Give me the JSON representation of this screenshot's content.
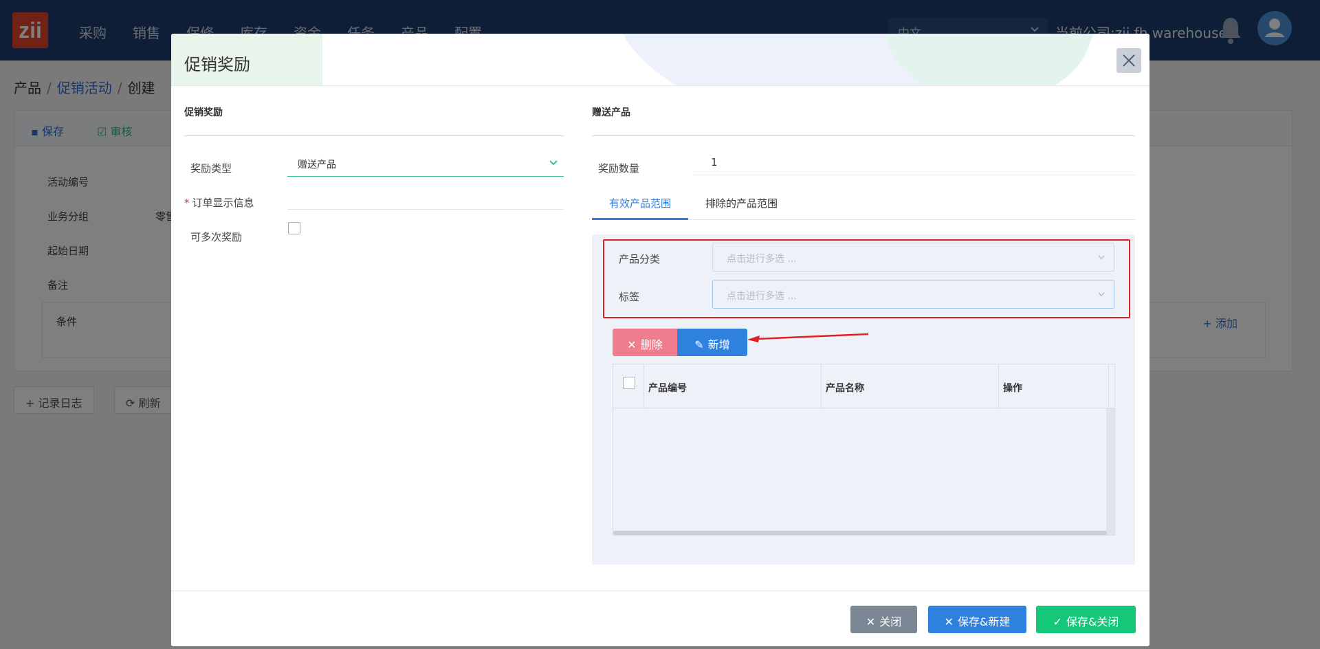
{
  "app": {
    "logo_text": "zii",
    "nav": [
      "采购",
      "销售",
      "保修",
      "库存",
      "资金",
      "任务",
      "产品",
      "配置"
    ],
    "language": "中文",
    "company": "当前公司:zii fb warehouse"
  },
  "breadcrumb": {
    "root": "产品",
    "middle": "促销活动",
    "current": "创建"
  },
  "page": {
    "toolbar": {
      "save": "保存",
      "audit": "审核"
    },
    "fields": [
      "活动编号",
      "业务分组",
      "起始日期",
      "备注"
    ],
    "group_value": "零售",
    "conditions_label": "条件",
    "add_label": "添加",
    "log_label": "记录日志",
    "refresh_label": "刷新"
  },
  "modal": {
    "title": "促销奖励",
    "left": {
      "section": "促销奖励",
      "reward_type_label": "奖励类型",
      "reward_type_value": "赠送产品",
      "order_info_label": "订单显示信息",
      "multi_label": "可多次奖励"
    },
    "right": {
      "section": "赠送产品",
      "qty_label": "奖励数量",
      "qty_value": "1",
      "tabs": [
        "有效产品范围",
        "排除的产品范围"
      ],
      "category_label": "产品分类",
      "category_placeholder": "点击进行多选 ...",
      "tag_label": "标签",
      "tag_placeholder": "点击进行多选 ...",
      "delete_button": "删除",
      "new_button": "新增",
      "columns": [
        "产品编号",
        "产品名称",
        "操作"
      ]
    },
    "footer": {
      "close": "关闭",
      "save_new": "保存&新建",
      "save_close": "保存&关闭"
    }
  },
  "colors": {
    "header_bg": "#1f3d6e",
    "accent_blue": "#2f81e0",
    "accent_green": "#14c779",
    "danger_pink": "#ef7d8d",
    "highlight_red": "#e02020"
  }
}
